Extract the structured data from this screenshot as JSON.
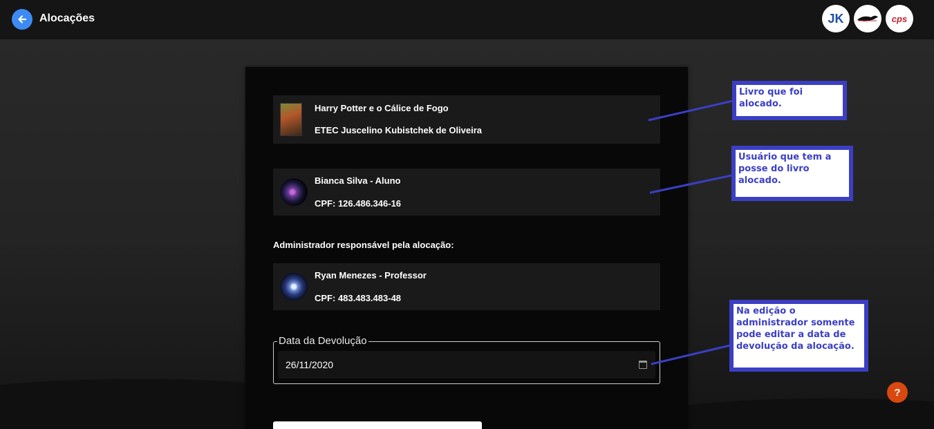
{
  "header": {
    "title": "Alocações",
    "logos": [
      {
        "name": "etec-logo",
        "text": "JK"
      },
      {
        "name": "mascot-logo",
        "text": ""
      },
      {
        "name": "cps-logo",
        "text": "cps"
      }
    ]
  },
  "book": {
    "title": "Harry Potter e o Cálice de Fogo",
    "school": "ETEC Juscelino Kubistchek de Oliveira"
  },
  "user": {
    "name": "Bianca Silva - Aluno",
    "cpf": "CPF: 126.486.346-16"
  },
  "admin": {
    "section_label": "Administrador responsável pela alocação:",
    "name": "Ryan Menezes - Professor",
    "cpf": "CPF: 483.483.483-48"
  },
  "return_date": {
    "legend": "Data da Devolução",
    "value": "26/11/2020"
  },
  "annotations": {
    "book": "Livro que foi alocado.",
    "user": "Usuário que tem a posse do livro alocado.",
    "edit": "Na edição o administrador somente pode editar a data de devolução da alocação."
  },
  "help": {
    "label": "?"
  },
  "colors": {
    "accent_blue": "#3d8bf2",
    "annotation_blue": "#3b3fc4",
    "help_orange": "#d9480f"
  }
}
